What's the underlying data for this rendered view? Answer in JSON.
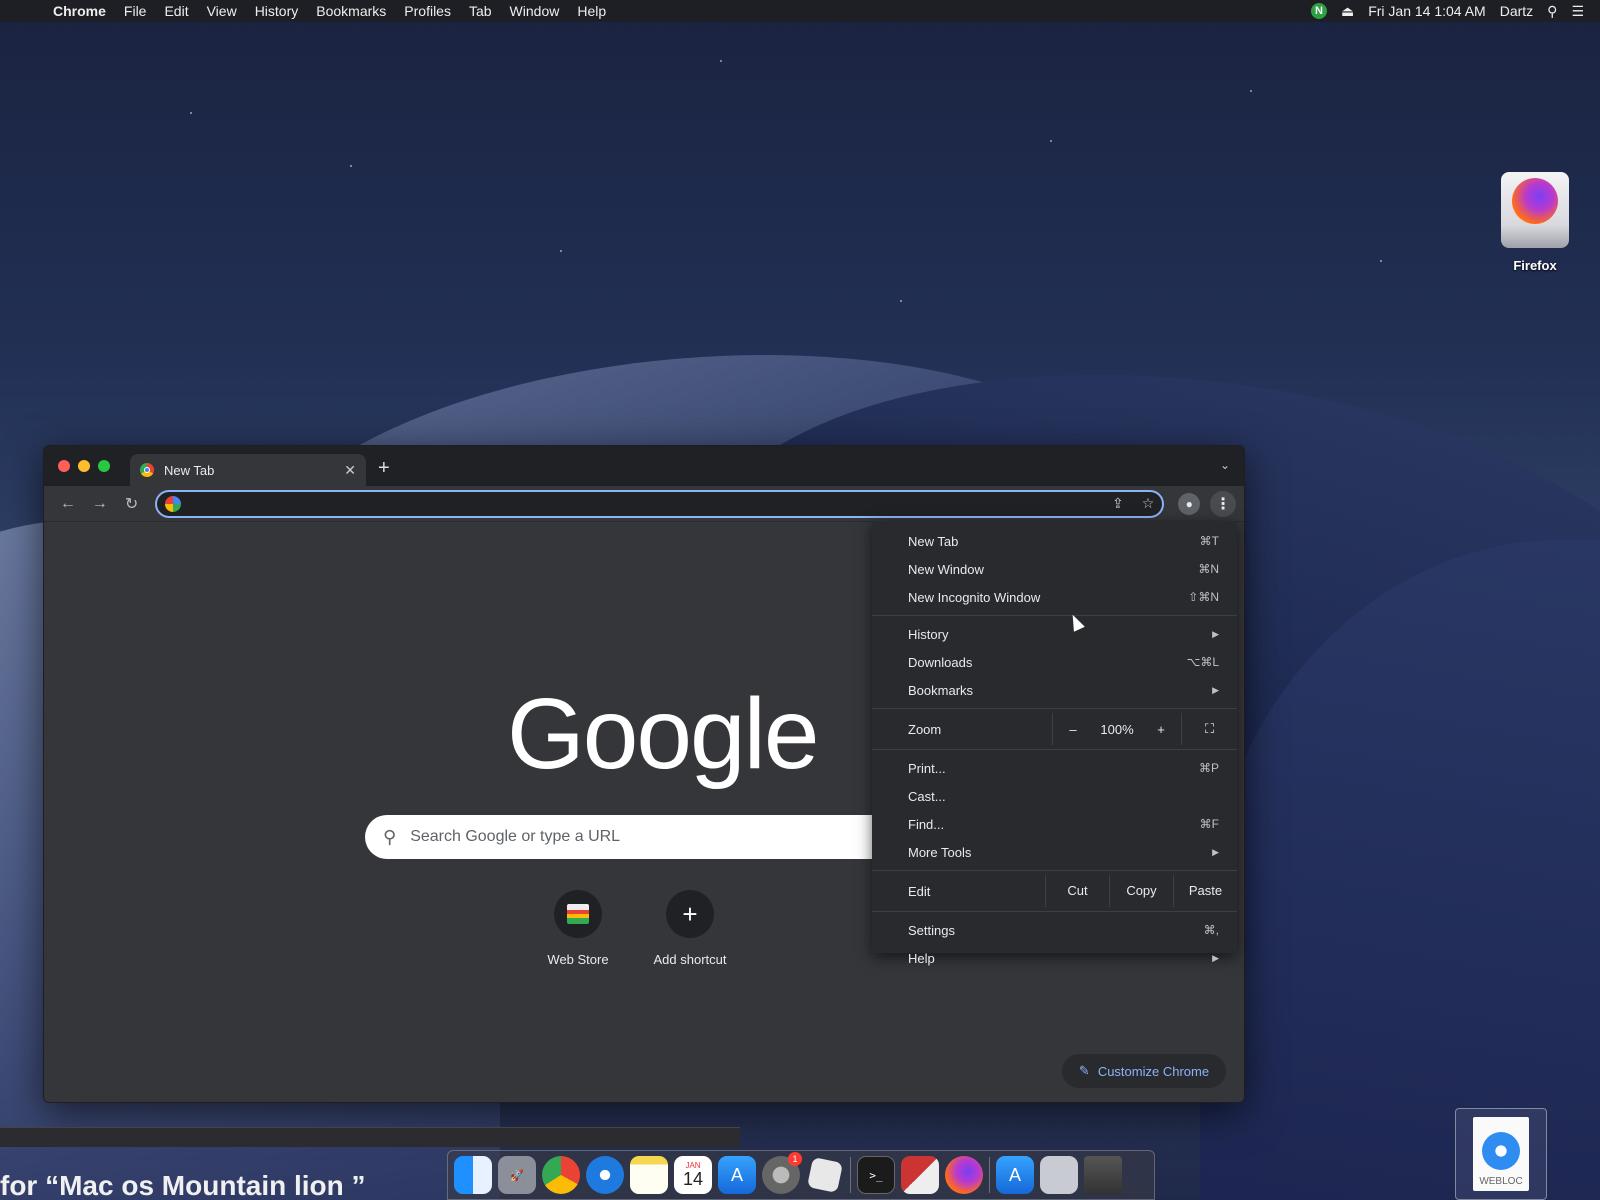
{
  "menubar": {
    "app": "Chrome",
    "items": [
      "File",
      "Edit",
      "View",
      "History",
      "Bookmarks",
      "Profiles",
      "Tab",
      "Window",
      "Help"
    ],
    "status_badge": "N",
    "datetime": "Fri Jan 14  1:04 AM",
    "user": "Dartz"
  },
  "desktop": {
    "firefox_label": "Firefox",
    "webloc_label": "WEBLOC"
  },
  "browser": {
    "tab_title": "New Tab",
    "omnibox_value": "",
    "logo_text": "Google",
    "search_placeholder": "Search Google or type a URL",
    "shortcuts": [
      {
        "label": "Web Store"
      },
      {
        "label": "Add shortcut"
      }
    ],
    "customize_label": "Customize Chrome"
  },
  "menu": {
    "new_tab": {
      "label": "New Tab",
      "shortcut": "⌘T"
    },
    "new_window": {
      "label": "New Window",
      "shortcut": "⌘N"
    },
    "new_incognito": {
      "label": "New Incognito Window",
      "shortcut": "⇧⌘N"
    },
    "history": {
      "label": "History"
    },
    "downloads": {
      "label": "Downloads",
      "shortcut": "⌥⌘L"
    },
    "bookmarks": {
      "label": "Bookmarks"
    },
    "zoom": {
      "label": "Zoom",
      "minus": "–",
      "value": "100%",
      "plus": "+"
    },
    "print": {
      "label": "Print...",
      "shortcut": "⌘P"
    },
    "cast": {
      "label": "Cast..."
    },
    "find": {
      "label": "Find...",
      "shortcut": "⌘F"
    },
    "more_tools": {
      "label": "More Tools"
    },
    "edit": {
      "label": "Edit",
      "cut": "Cut",
      "copy": "Copy",
      "paste": "Paste"
    },
    "settings": {
      "label": "Settings",
      "shortcut": "⌘,"
    },
    "help": {
      "label": "Help"
    }
  },
  "caption_text": "for “Mac os Mountain lion ”",
  "dock": {
    "calendar_month": "JAN",
    "calendar_day": "14",
    "notification_badge": "1"
  }
}
